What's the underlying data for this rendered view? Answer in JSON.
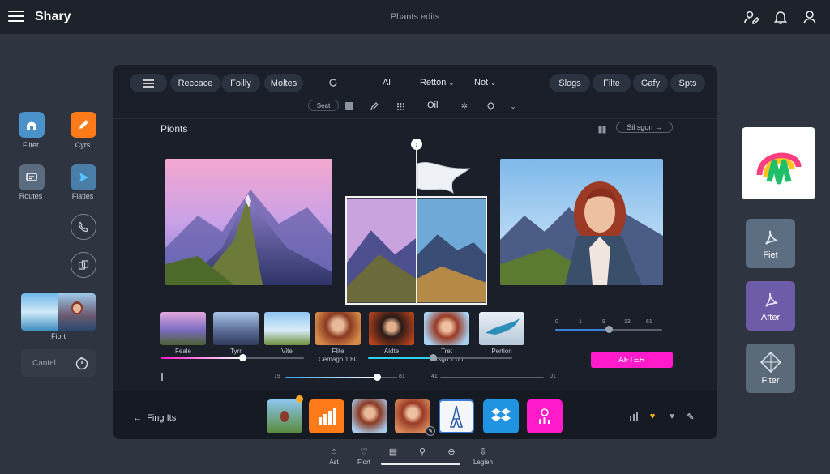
{
  "app": {
    "brand": "Shary",
    "page_title": "Phants edits"
  },
  "top_icons": [
    "user-edit-icon",
    "bell-icon",
    "profile-icon"
  ],
  "left_rail": {
    "items": [
      {
        "label": "Filter",
        "icon": "home-icon",
        "color": "#4a92c9"
      },
      {
        "label": "Cyrs",
        "icon": "pencil-icon",
        "color": "#ff7a18"
      },
      {
        "label": "Routes",
        "icon": "chat-icon",
        "color": "#5b6b80"
      },
      {
        "label": "Flatles",
        "icon": "send-icon",
        "color": "#4a7ea8"
      }
    ],
    "preview_label": "Fiort",
    "cancel_label": "Cantel"
  },
  "toolbar": {
    "left_pills": [
      "Reccace",
      "Foilly",
      "Moltes"
    ],
    "middle": [
      "Al",
      "Retton",
      "Not"
    ],
    "right_pills": [
      "Slogs",
      "Filte",
      "Gafy",
      "Spts"
    ],
    "row2_select": "Seat",
    "row2_text": "Oil"
  },
  "canvas": {
    "section_title": "Pionts",
    "sign_button": "Sil sgon"
  },
  "thumbnails": {
    "labels": [
      "Feale",
      "Tyrr",
      "Vite",
      "Flite",
      "Aidte",
      "Tret",
      "Pertion"
    ],
    "sublabels": [
      "Cemagh 1:80",
      "Sksgh 1:00"
    ]
  },
  "sliders": {
    "right_ticks": [
      "0",
      "1",
      "9",
      "13",
      "61"
    ],
    "mid_ticks": [
      "19",
      "81"
    ],
    "far_ticks": [
      "41",
      "01"
    ],
    "levels": {
      "left_pink": 0.57,
      "mid": 0.82,
      "right": 0.5,
      "cyan": 0.45
    }
  },
  "after_button": "AFTER",
  "bottom_strip": {
    "back_label": "Fing Its"
  },
  "right_rail": [
    "Fiet",
    "After",
    "Fiter"
  ],
  "bottom_nav": [
    "Ast",
    "Fiort",
    "",
    "",
    "",
    "Legien"
  ],
  "colors": {
    "accent_pink": "#ff1aca",
    "accent_orange": "#ff7a18",
    "accent_blue": "#2094e0",
    "bg": "#2e3440"
  }
}
